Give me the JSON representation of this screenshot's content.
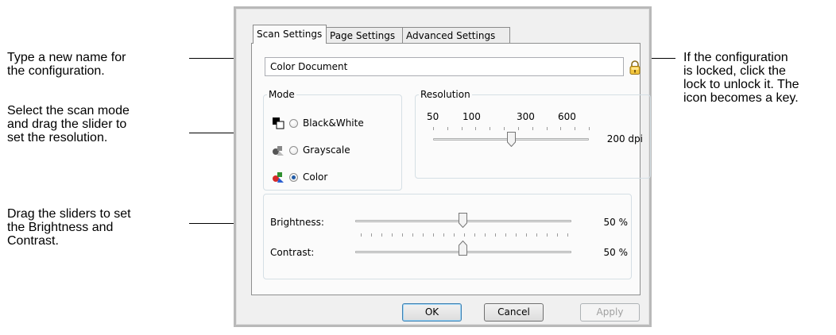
{
  "callouts": {
    "name": "Type a new name for\nthe configuration.",
    "mode": "Select the scan mode\nand drag the slider to\nset the resolution.",
    "sliders": "Drag the sliders to set\nthe Brightness and\nContrast.",
    "lock": "If the configuration\nis locked, click the\nlock to unlock it. The\nicon becomes a key."
  },
  "dialog": {
    "tabs": [
      {
        "label": "Scan Settings",
        "active": true
      },
      {
        "label": "Page Settings",
        "active": false
      },
      {
        "label": "Advanced Settings",
        "active": false
      }
    ],
    "config_name": "Color Document",
    "lock_icon": "padlock-icon",
    "mode": {
      "legend": "Mode",
      "options": [
        {
          "label": "Black&White",
          "icon": "black-white-icon",
          "checked": false
        },
        {
          "label": "Grayscale",
          "icon": "grayscale-icon",
          "checked": false
        },
        {
          "label": "Color",
          "icon": "color-icon",
          "checked": true
        }
      ]
    },
    "resolution": {
      "legend": "Resolution",
      "tick_labels": [
        "50",
        "100",
        "300",
        "600"
      ],
      "value": "200 dpi",
      "slider_fraction": 0.5
    },
    "brightness": {
      "label": "Brightness:",
      "value": "50 %",
      "slider_fraction": 0.5
    },
    "contrast": {
      "label": "Contrast:",
      "value": "50 %",
      "slider_fraction": 0.5
    },
    "buttons": {
      "ok": "OK",
      "cancel": "Cancel",
      "apply": "Apply"
    }
  },
  "colors": {
    "accent": "#1f5aa6",
    "lock": "#e8b52c"
  }
}
